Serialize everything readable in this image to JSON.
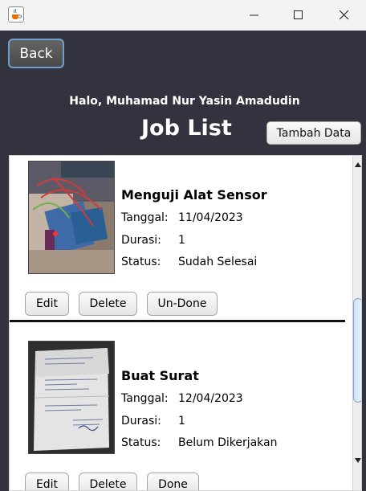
{
  "window": {
    "app_icon": "java-coffee-icon",
    "controls": [
      "minimize-icon",
      "maximize-icon",
      "close-icon"
    ]
  },
  "header": {
    "back_label": "Back",
    "greeting": "Halo, Muhamad Nur Yasin Amadudin",
    "title": "Job List",
    "add_label": "Tambah Data"
  },
  "jobs": [
    {
      "title": "Menguji Alat Sensor",
      "tanggal_label": "Tanggal:",
      "tanggal": "11/04/2023",
      "durasi_label": "Durasi:",
      "durasi": "1",
      "status_label": "Status:",
      "status": "Sudah Selesai",
      "edit_label": "Edit",
      "delete_label": "Delete",
      "toggle_label": "Un-Done"
    },
    {
      "title": "Buat Surat",
      "tanggal_label": "Tanggal:",
      "tanggal": "12/04/2023",
      "durasi_label": "Durasi:",
      "durasi": "1",
      "status_label": "Status:",
      "status": "Belum Dikerjakan",
      "edit_label": "Edit",
      "delete_label": "Delete",
      "toggle_label": "Done"
    }
  ]
}
